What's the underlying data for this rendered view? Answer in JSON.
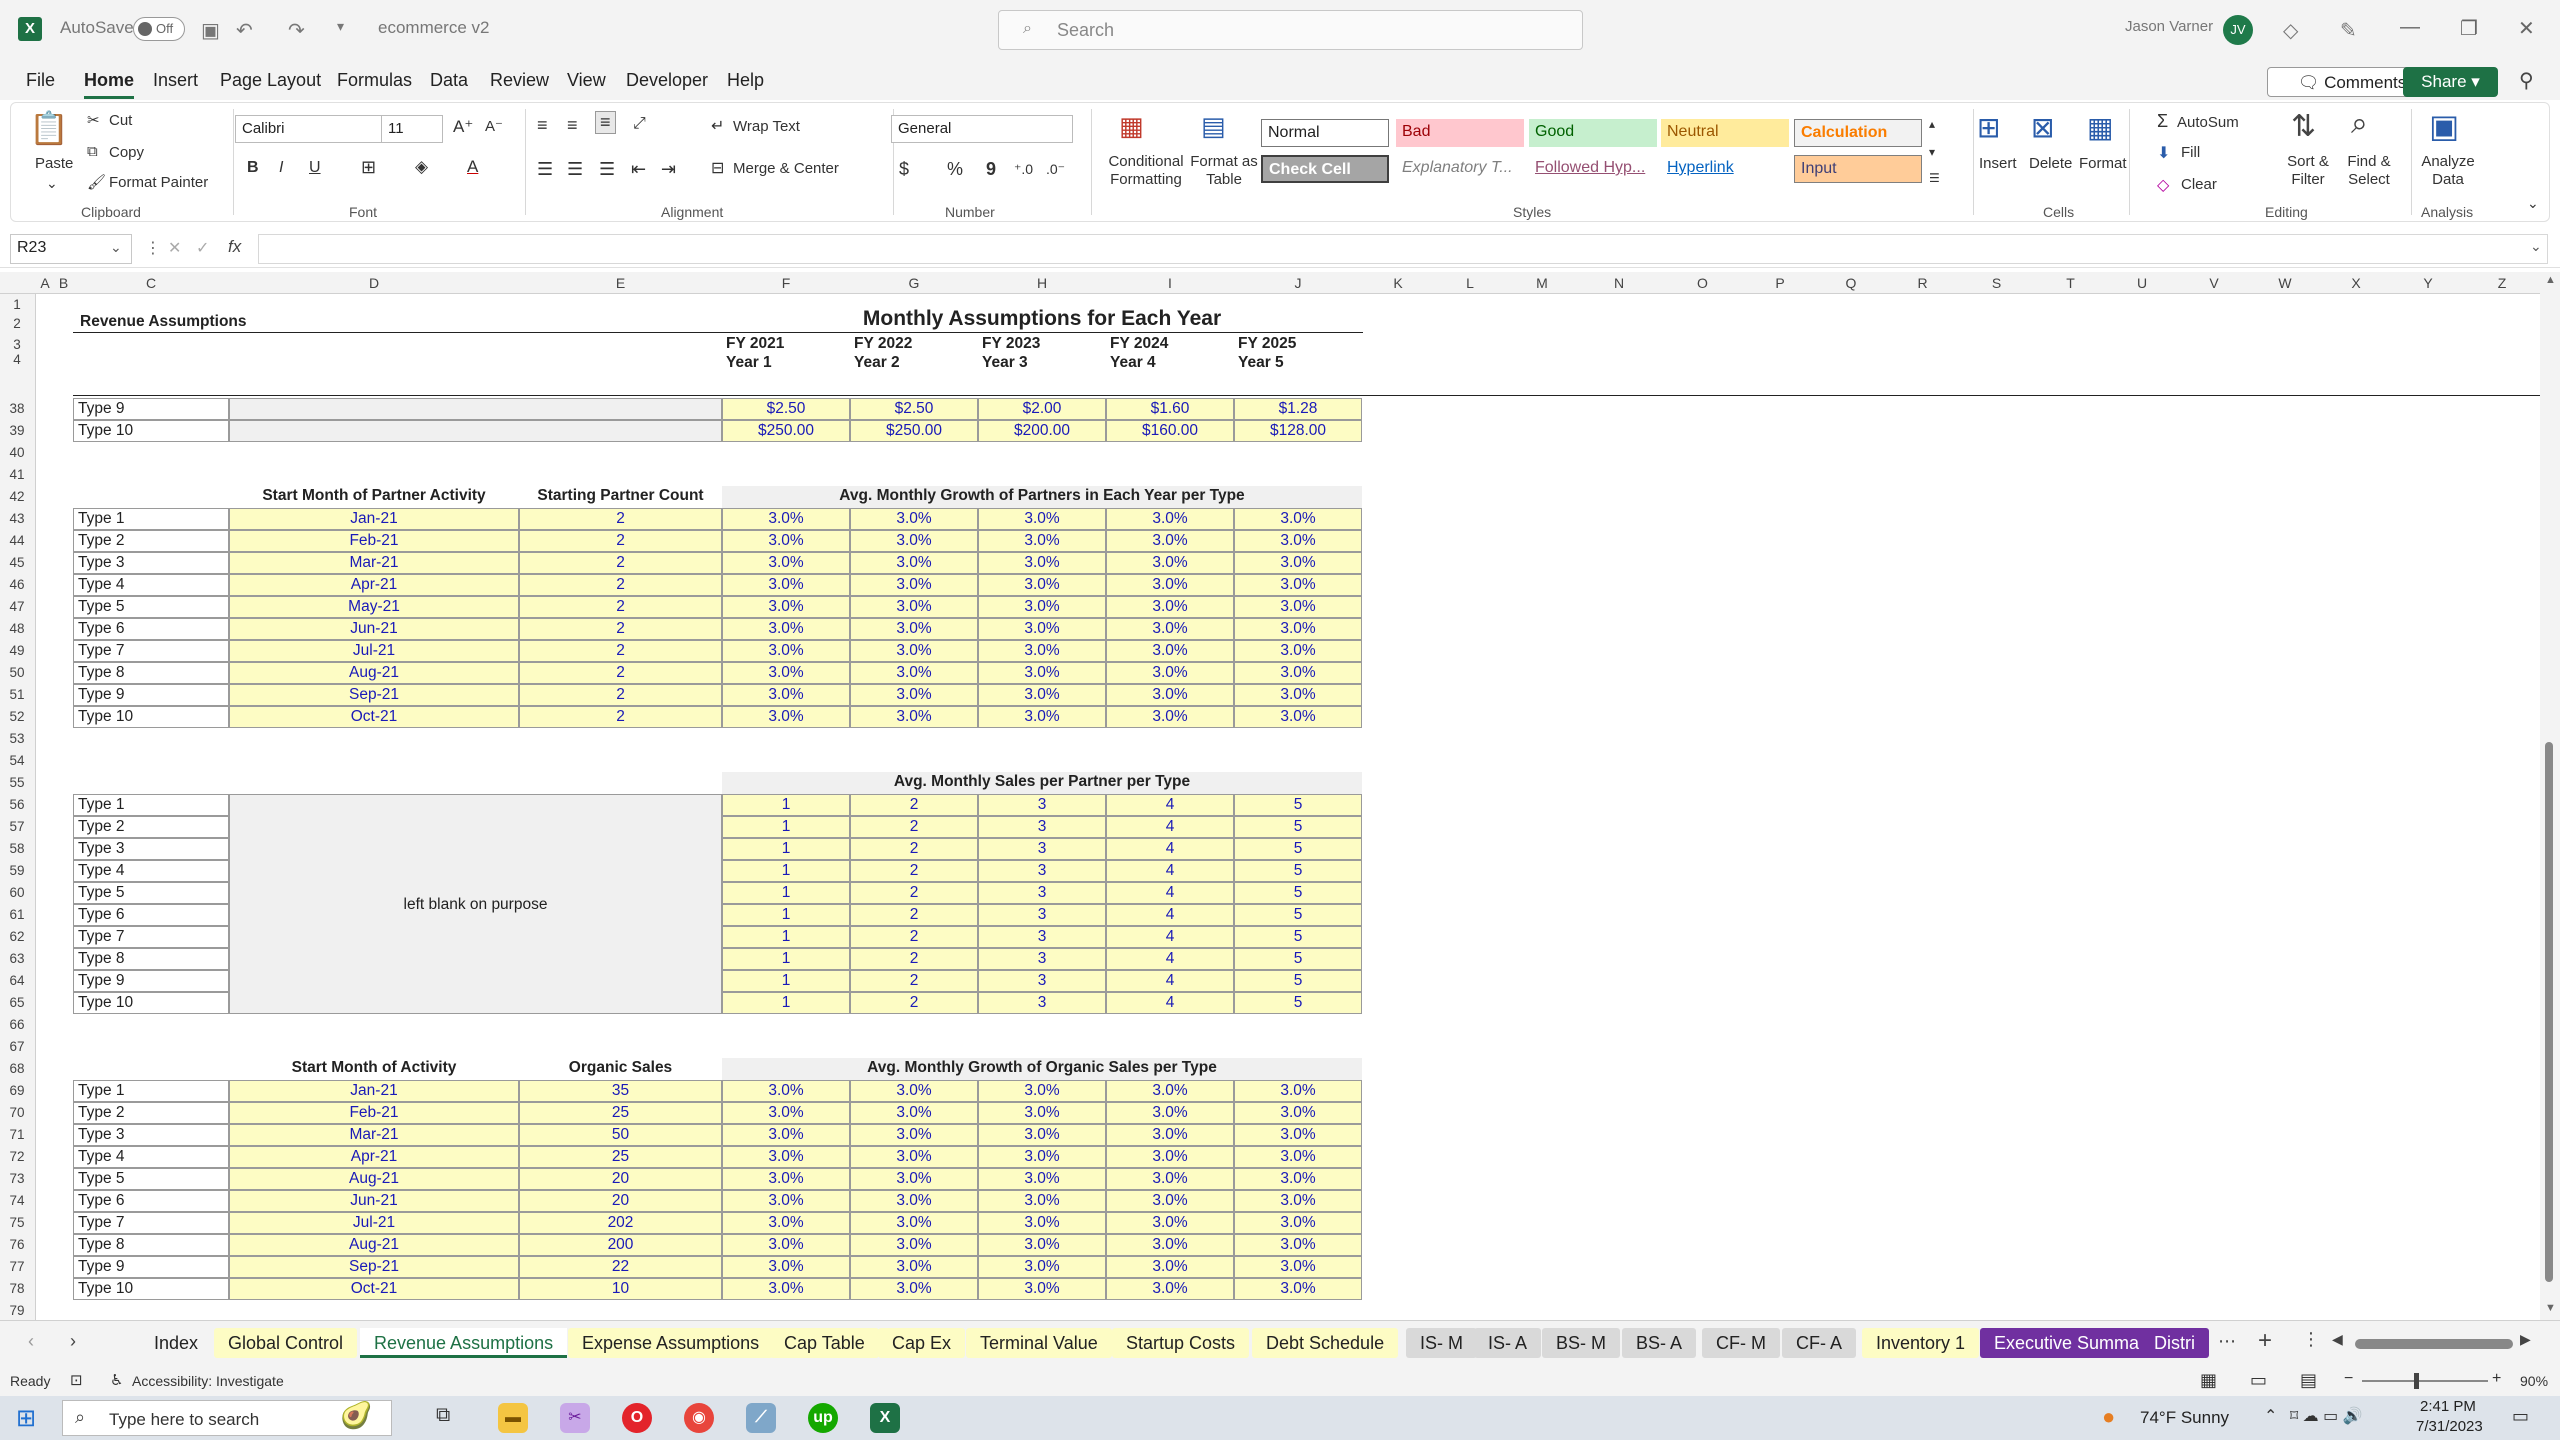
{
  "titlebar": {
    "app_icon": "X",
    "autosave_label": "AutoSave",
    "autosave_state": "Off",
    "doc_title": "ecommerce v2",
    "search_placeholder": "Search",
    "user_name": "Jason Varner",
    "user_initials": "JV"
  },
  "menu": {
    "tabs": [
      "File",
      "Home",
      "Insert",
      "Page Layout",
      "Formulas",
      "Data",
      "Review",
      "View",
      "Developer",
      "Help"
    ],
    "active": "Home",
    "comments_label": "Comments",
    "share_label": "Share"
  },
  "ribbon": {
    "clipboard": {
      "paste": "Paste",
      "cut": "Cut",
      "copy": "Copy",
      "format_painter": "Format Painter",
      "group": "Clipboard"
    },
    "font": {
      "family": "Calibri",
      "size": "11",
      "group": "Font",
      "bold": "B",
      "italic": "I",
      "underline": "U"
    },
    "alignment": {
      "wrap_text": "Wrap Text",
      "merge_center": "Merge & Center",
      "group": "Alignment"
    },
    "number": {
      "format": "General",
      "currency": "$",
      "percent": "%",
      "comma": "9",
      "group": "Number"
    },
    "styles": {
      "conditional": "Conditional Formatting",
      "format_table": "Format as Table",
      "group": "Styles",
      "cells": [
        "Normal",
        "Bad",
        "Good",
        "Neutral",
        "Calculation",
        "Check Cell",
        "Explanatory T...",
        "Followed Hyp...",
        "Hyperlink",
        "Input"
      ]
    },
    "cells": {
      "insert": "Insert",
      "delete": "Delete",
      "format": "Format",
      "group": "Cells"
    },
    "editing": {
      "autosum": "AutoSum",
      "fill": "Fill",
      "clear": "Clear",
      "sort_filter": "Sort & Filter",
      "find_select": "Find & Select",
      "group": "Editing"
    },
    "analysis": {
      "analyze": "Analyze Data",
      "group": "Analysis"
    }
  },
  "formula_bar": {
    "name_box": "R23",
    "fx": "fx",
    "formula": ""
  },
  "columns": [
    "A",
    "B",
    "C",
    "D",
    "E",
    "F",
    "G",
    "H",
    "I",
    "J",
    "K",
    "L",
    "M",
    "N",
    "O",
    "P",
    "Q",
    "R",
    "S",
    "T",
    "U",
    "V",
    "W",
    "X",
    "Y",
    "Z"
  ],
  "rows": [
    "1",
    "2",
    "3",
    "4",
    "38",
    "39",
    "40",
    "41",
    "42",
    "43",
    "44",
    "45",
    "46",
    "47",
    "48",
    "49",
    "50",
    "51",
    "52",
    "53",
    "54",
    "55",
    "56",
    "57",
    "58",
    "59",
    "60",
    "61",
    "62",
    "63",
    "64",
    "65",
    "66",
    "67",
    "68",
    "69",
    "70",
    "71",
    "72",
    "73",
    "74",
    "75",
    "76",
    "77",
    "78",
    "79"
  ],
  "sheet": {
    "section_title": "Revenue Assumptions",
    "main_title": "Monthly Assumptions for Each Year",
    "fy": [
      "FY 2021",
      "FY 2022",
      "FY 2023",
      "FY 2024",
      "FY 2025"
    ],
    "years": [
      "Year 1",
      "Year 2",
      "Year 3",
      "Year 4",
      "Year 5"
    ],
    "top_rows": [
      {
        "label": "Type 9",
        "values": [
          "$2.50",
          "$2.50",
          "$2.00",
          "$1.60",
          "$1.28"
        ]
      },
      {
        "label": "Type 10",
        "values": [
          "$250.00",
          "$250.00",
          "$200.00",
          "$160.00",
          "$128.00"
        ]
      }
    ],
    "partners": {
      "col_c": "Start Month of Partner Activity",
      "col_e": "Starting Partner Count",
      "header": "Avg. Monthly Growth of Partners in Each Year per Type",
      "rows": [
        {
          "label": "Type 1",
          "month": "Jan-21",
          "count": "2",
          "values": [
            "3.0%",
            "3.0%",
            "3.0%",
            "3.0%",
            "3.0%"
          ]
        },
        {
          "label": "Type 2",
          "month": "Feb-21",
          "count": "2",
          "values": [
            "3.0%",
            "3.0%",
            "3.0%",
            "3.0%",
            "3.0%"
          ]
        },
        {
          "label": "Type 3",
          "month": "Mar-21",
          "count": "2",
          "values": [
            "3.0%",
            "3.0%",
            "3.0%",
            "3.0%",
            "3.0%"
          ]
        },
        {
          "label": "Type 4",
          "month": "Apr-21",
          "count": "2",
          "values": [
            "3.0%",
            "3.0%",
            "3.0%",
            "3.0%",
            "3.0%"
          ]
        },
        {
          "label": "Type 5",
          "month": "May-21",
          "count": "2",
          "values": [
            "3.0%",
            "3.0%",
            "3.0%",
            "3.0%",
            "3.0%"
          ]
        },
        {
          "label": "Type 6",
          "month": "Jun-21",
          "count": "2",
          "values": [
            "3.0%",
            "3.0%",
            "3.0%",
            "3.0%",
            "3.0%"
          ]
        },
        {
          "label": "Type 7",
          "month": "Jul-21",
          "count": "2",
          "values": [
            "3.0%",
            "3.0%",
            "3.0%",
            "3.0%",
            "3.0%"
          ]
        },
        {
          "label": "Type 8",
          "month": "Aug-21",
          "count": "2",
          "values": [
            "3.0%",
            "3.0%",
            "3.0%",
            "3.0%",
            "3.0%"
          ]
        },
        {
          "label": "Type 9",
          "month": "Sep-21",
          "count": "2",
          "values": [
            "3.0%",
            "3.0%",
            "3.0%",
            "3.0%",
            "3.0%"
          ]
        },
        {
          "label": "Type 10",
          "month": "Oct-21",
          "count": "2",
          "values": [
            "3.0%",
            "3.0%",
            "3.0%",
            "3.0%",
            "3.0%"
          ]
        }
      ]
    },
    "sales": {
      "header": "Avg. Monthly Sales per Partner per Type",
      "blank_note": "left blank on purpose",
      "rows": [
        {
          "label": "Type 1",
          "values": [
            "1",
            "2",
            "3",
            "4",
            "5"
          ]
        },
        {
          "label": "Type 2",
          "values": [
            "1",
            "2",
            "3",
            "4",
            "5"
          ]
        },
        {
          "label": "Type 3",
          "values": [
            "1",
            "2",
            "3",
            "4",
            "5"
          ]
        },
        {
          "label": "Type 4",
          "values": [
            "1",
            "2",
            "3",
            "4",
            "5"
          ]
        },
        {
          "label": "Type 5",
          "values": [
            "1",
            "2",
            "3",
            "4",
            "5"
          ]
        },
        {
          "label": "Type 6",
          "values": [
            "1",
            "2",
            "3",
            "4",
            "5"
          ]
        },
        {
          "label": "Type 7",
          "values": [
            "1",
            "2",
            "3",
            "4",
            "5"
          ]
        },
        {
          "label": "Type 8",
          "values": [
            "1",
            "2",
            "3",
            "4",
            "5"
          ]
        },
        {
          "label": "Type 9",
          "values": [
            "1",
            "2",
            "3",
            "4",
            "5"
          ]
        },
        {
          "label": "Type 10",
          "values": [
            "1",
            "2",
            "3",
            "4",
            "5"
          ]
        }
      ]
    },
    "organic": {
      "col_c": "Start Month of Activity",
      "col_e": "Organic Sales",
      "header": "Avg. Monthly Growth of Organic Sales per Type",
      "rows": [
        {
          "label": "Type 1",
          "month": "Jan-21",
          "count": "35",
          "values": [
            "3.0%",
            "3.0%",
            "3.0%",
            "3.0%",
            "3.0%"
          ]
        },
        {
          "label": "Type 2",
          "month": "Feb-21",
          "count": "25",
          "values": [
            "3.0%",
            "3.0%",
            "3.0%",
            "3.0%",
            "3.0%"
          ]
        },
        {
          "label": "Type 3",
          "month": "Mar-21",
          "count": "50",
          "values": [
            "3.0%",
            "3.0%",
            "3.0%",
            "3.0%",
            "3.0%"
          ]
        },
        {
          "label": "Type 4",
          "month": "Apr-21",
          "count": "25",
          "values": [
            "3.0%",
            "3.0%",
            "3.0%",
            "3.0%",
            "3.0%"
          ]
        },
        {
          "label": "Type 5",
          "month": "Aug-21",
          "count": "20",
          "values": [
            "3.0%",
            "3.0%",
            "3.0%",
            "3.0%",
            "3.0%"
          ]
        },
        {
          "label": "Type 6",
          "month": "Jun-21",
          "count": "20",
          "values": [
            "3.0%",
            "3.0%",
            "3.0%",
            "3.0%",
            "3.0%"
          ]
        },
        {
          "label": "Type 7",
          "month": "Jul-21",
          "count": "202",
          "values": [
            "3.0%",
            "3.0%",
            "3.0%",
            "3.0%",
            "3.0%"
          ]
        },
        {
          "label": "Type 8",
          "month": "Aug-21",
          "count": "200",
          "values": [
            "3.0%",
            "3.0%",
            "3.0%",
            "3.0%",
            "3.0%"
          ]
        },
        {
          "label": "Type 9",
          "month": "Sep-21",
          "count": "22",
          "values": [
            "3.0%",
            "3.0%",
            "3.0%",
            "3.0%",
            "3.0%"
          ]
        },
        {
          "label": "Type 10",
          "month": "Oct-21",
          "count": "10",
          "values": [
            "3.0%",
            "3.0%",
            "3.0%",
            "3.0%",
            "3.0%"
          ]
        }
      ]
    }
  },
  "sheet_tabs": [
    {
      "label": "Index",
      "color": "#f3f3f3"
    },
    {
      "label": "Global Control",
      "color": "#fdfcc4"
    },
    {
      "label": "Revenue Assumptions",
      "color": "#ffffff",
      "active": true
    },
    {
      "label": "Expense Assumptions",
      "color": "#fdfcc4"
    },
    {
      "label": "Cap Table",
      "color": "#fdfcc4"
    },
    {
      "label": "Cap Ex",
      "color": "#fdfcc4"
    },
    {
      "label": "Terminal Value",
      "color": "#fdfcc4"
    },
    {
      "label": "Startup Costs",
      "color": "#fdfcc4"
    },
    {
      "label": "Debt Schedule",
      "color": "#fdfcc4"
    },
    {
      "label": "IS- M",
      "color": "#d9d9d9"
    },
    {
      "label": "IS- A",
      "color": "#d9d9d9"
    },
    {
      "label": "BS- M",
      "color": "#d9d9d9"
    },
    {
      "label": "BS- A",
      "color": "#d9d9d9"
    },
    {
      "label": "CF- M",
      "color": "#d9d9d9"
    },
    {
      "label": "CF- A",
      "color": "#d9d9d9"
    },
    {
      "label": "Inventory 1",
      "color": "#fdfcc4"
    },
    {
      "label": "Executive Summary",
      "color": "#7030a0"
    },
    {
      "label": "Distri",
      "color": "#7030a0"
    }
  ],
  "status": {
    "ready": "Ready",
    "accessibility": "Accessibility: Investigate",
    "zoom": "90%"
  },
  "taskbar": {
    "search_placeholder": "Type here to search",
    "weather": "74°F  Sunny",
    "time": "2:41 PM",
    "date": "7/31/2023"
  },
  "colors": {
    "accent": "#1e7145",
    "input_fill": "#fdfcc4",
    "input_text": "#1a1ab8"
  }
}
